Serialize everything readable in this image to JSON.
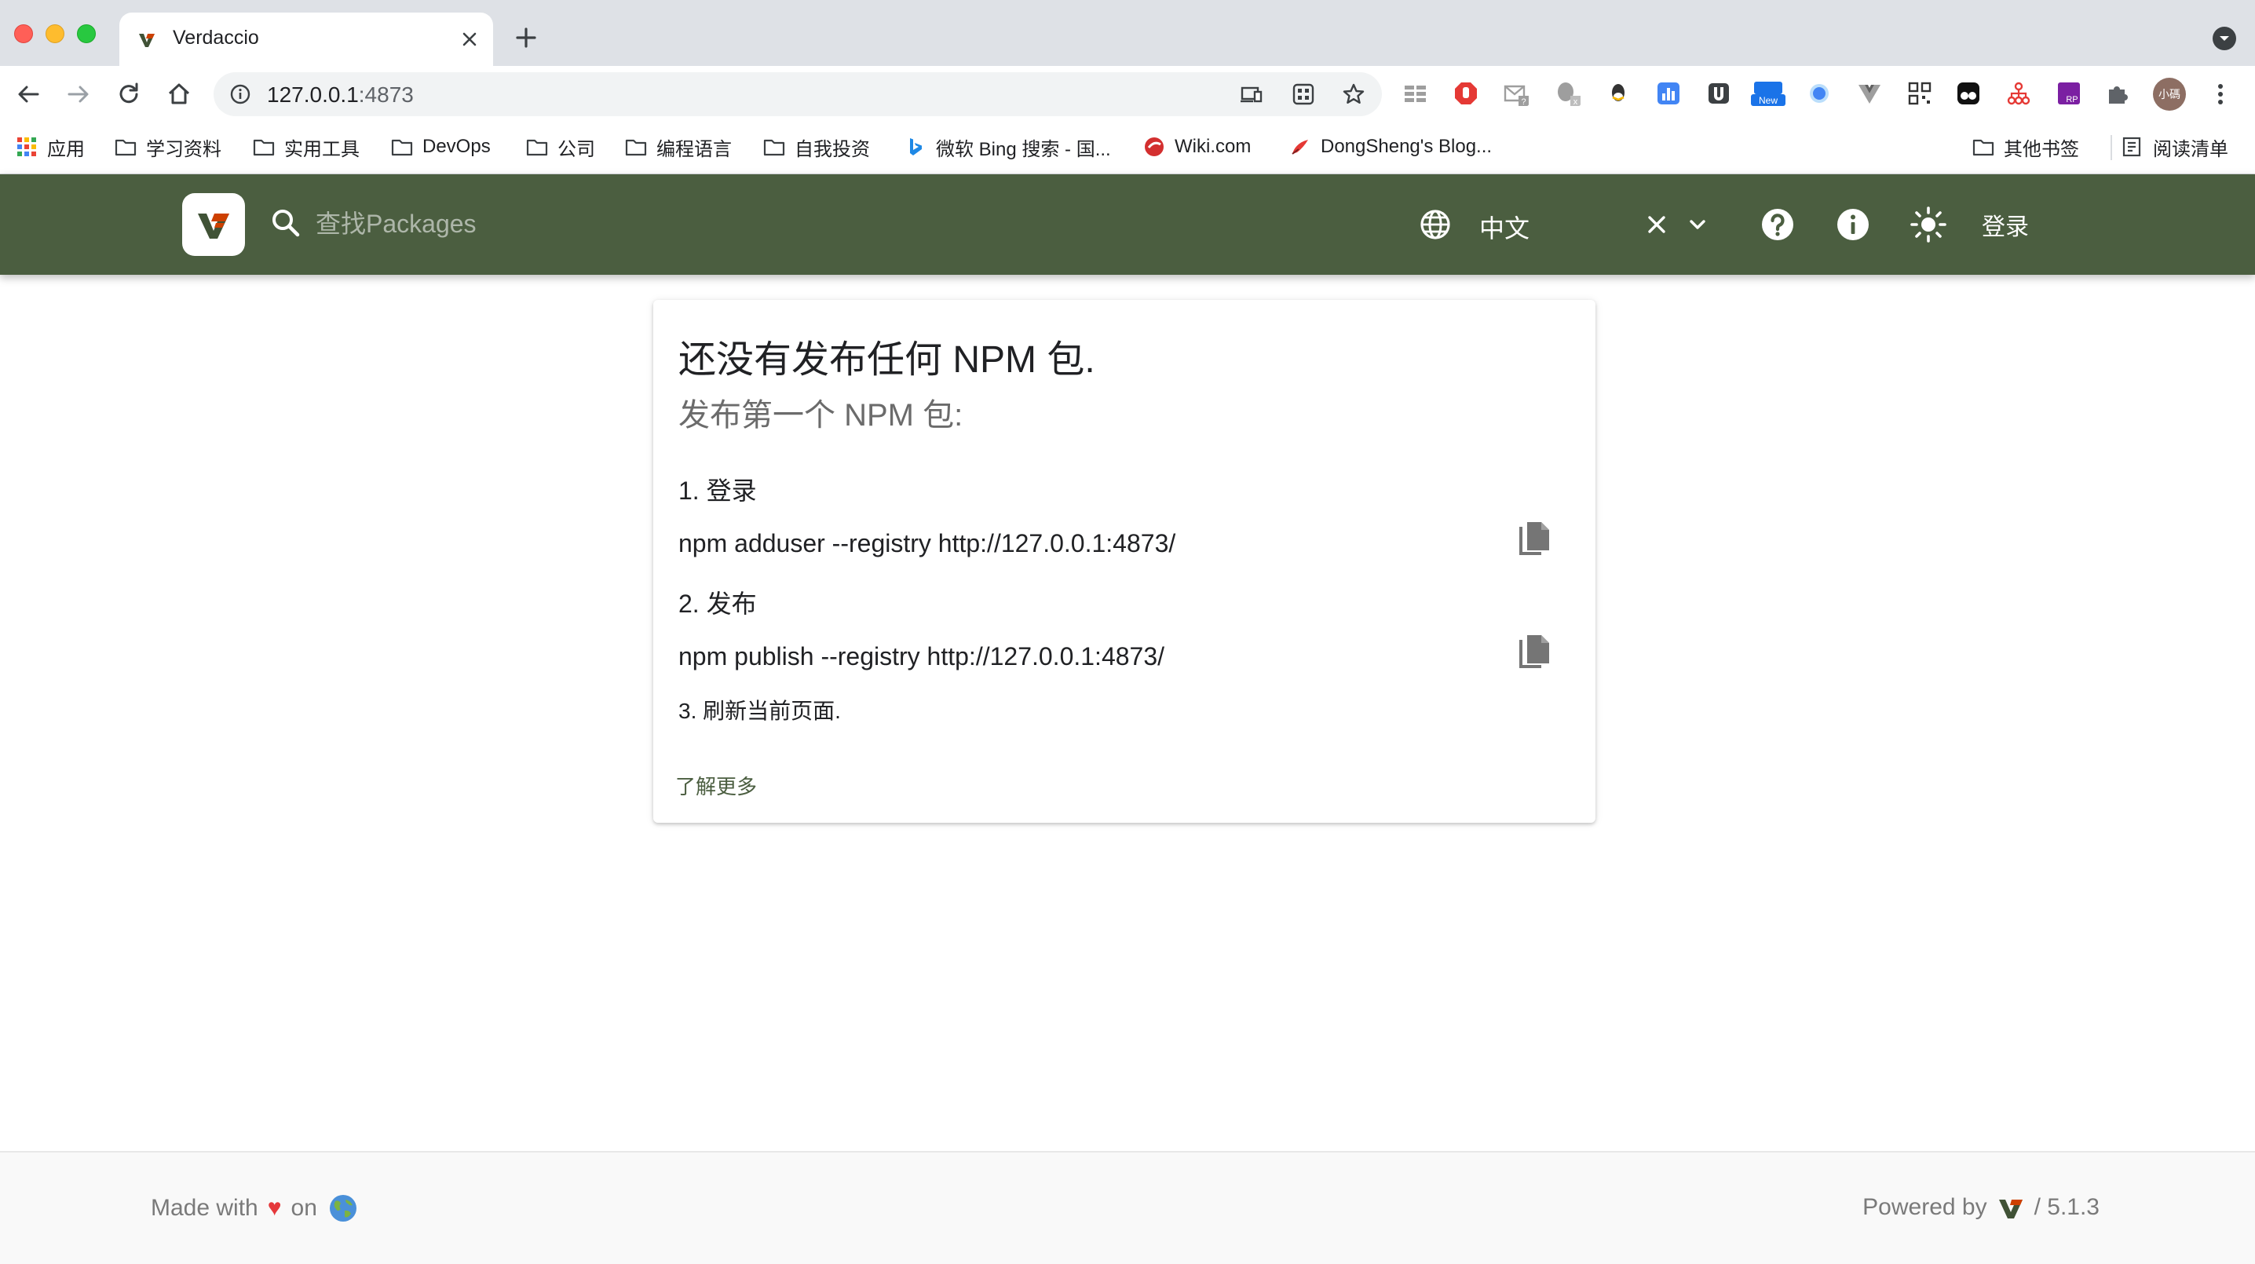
{
  "browser": {
    "tab": {
      "title": "Verdaccio"
    },
    "omnibox": {
      "host": "127.0.0.1",
      "port": ":4873"
    },
    "extensions": [
      {
        "name": "adblock-extension-icon",
        "color": "#e53935"
      },
      {
        "name": "gmail-checker-icon",
        "color": "#9e9e9e"
      },
      {
        "name": "evernote-icon",
        "color": "#9e9e9e"
      },
      {
        "name": "qq-icon",
        "color": "#333333"
      },
      {
        "name": "analytics-extension-icon",
        "color": "#4285f4"
      },
      {
        "name": "shield-extension-icon",
        "color": "#3c4043"
      },
      {
        "name": "new-badge-extension-icon",
        "color": "#1a73e8"
      },
      {
        "name": "circle-extension-icon",
        "color": "#4285f4"
      },
      {
        "name": "vue-devtools-icon",
        "color": "#8a8a8a"
      },
      {
        "name": "qrcode-icon",
        "color": "#333333"
      },
      {
        "name": "tampermonkey-icon",
        "color": "#111111"
      },
      {
        "name": "sitemap-extension-icon",
        "color": "#e53935"
      },
      {
        "name": "rp-extension-icon",
        "color": "#7b1fa2"
      },
      {
        "name": "puzzle-extensions-icon",
        "color": "#5f6368"
      }
    ],
    "profile": {
      "avatar_text": "小碼"
    },
    "bookmarks": [
      {
        "label": "应用",
        "icon": "apps-grid-icon"
      },
      {
        "label": "学习资料",
        "icon": "folder-icon"
      },
      {
        "label": "实用工具",
        "icon": "folder-icon"
      },
      {
        "label": "DevOps",
        "icon": "folder-icon"
      },
      {
        "label": "公司",
        "icon": "folder-icon"
      },
      {
        "label": "编程语言",
        "icon": "folder-icon"
      },
      {
        "label": "自我投资",
        "icon": "folder-icon"
      },
      {
        "label": "微软 Bing 搜索 - 国...",
        "icon": "bing-icon"
      },
      {
        "label": "Wiki.com",
        "icon": "wiki-icon"
      },
      {
        "label": "DongSheng's Blog...",
        "icon": "blog-icon"
      }
    ],
    "bookmarks_right": [
      {
        "label": "其他书签",
        "icon": "folder-icon"
      },
      {
        "label": "阅读清单",
        "icon": "reading-list-icon"
      }
    ]
  },
  "header": {
    "search": {
      "placeholder": "查找Packages"
    },
    "language": {
      "value": "中文"
    },
    "login_label": "登录",
    "brand_color": "#4b5e40"
  },
  "main": {
    "title": "还没有发布任何 NPM 包.",
    "subtitle": "发布第一个 NPM 包:",
    "steps": [
      {
        "label": "1. 登录",
        "command": "npm adduser --registry http://127.0.0.1:4873/"
      },
      {
        "label": "2. 发布",
        "command": "npm publish --registry http://127.0.0.1:4873/"
      },
      {
        "label": "3. 刷新当前页面."
      }
    ],
    "learn_more": "了解更多"
  },
  "footer": {
    "made_with": "Made with",
    "heart": "♥",
    "on": "on",
    "powered_by": "Powered by",
    "version": "/ 5.1.3"
  }
}
